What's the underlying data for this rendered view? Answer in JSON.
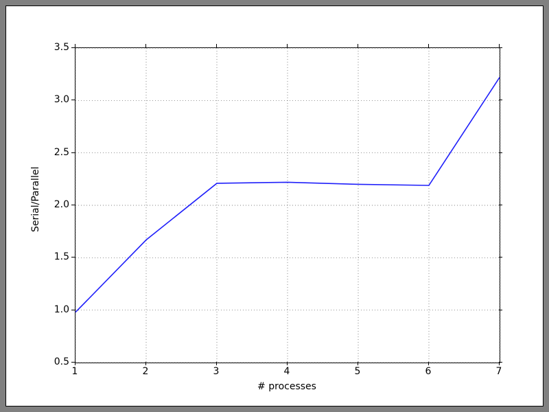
{
  "chart_data": {
    "type": "line",
    "x": [
      1,
      2,
      3,
      4,
      5,
      6,
      7
    ],
    "values": [
      0.98,
      1.67,
      2.21,
      2.22,
      2.2,
      2.19,
      3.22
    ],
    "xlabel": "# processes",
    "ylabel": "Serial/Parallel",
    "xlim": [
      1,
      7
    ],
    "ylim": [
      0.5,
      3.5
    ],
    "xticks": [
      1,
      2,
      3,
      4,
      5,
      6,
      7
    ],
    "yticks": [
      0.5,
      1.0,
      1.5,
      2.0,
      2.5,
      3.0,
      3.5
    ],
    "ytick_labels": [
      "0.5",
      "1.0",
      "1.5",
      "2.0",
      "2.5",
      "3.0",
      "3.5"
    ],
    "xtick_labels": [
      "1",
      "2",
      "3",
      "4",
      "5",
      "6",
      "7"
    ],
    "grid": true,
    "line_color": "#1f1ffa"
  }
}
